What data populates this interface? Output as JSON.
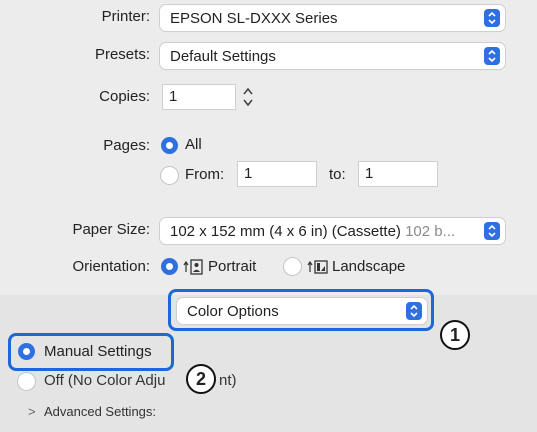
{
  "printer": {
    "label": "Printer:",
    "value": "EPSON SL-DXXX Series"
  },
  "presets": {
    "label": "Presets:",
    "value": "Default Settings"
  },
  "copies": {
    "label": "Copies:",
    "value": "1"
  },
  "pages": {
    "label": "Pages:",
    "all_label": "All",
    "from_label": "From:",
    "from_value": "1",
    "to_label": "to:",
    "to_value": "1"
  },
  "paper_size": {
    "label": "Paper Size:",
    "value": "102 x 152 mm (4 x 6 in) (Cassette)",
    "value_dim": "102 b..."
  },
  "orientation": {
    "label": "Orientation:",
    "portrait_label": "Portrait",
    "landscape_label": "Landscape"
  },
  "color_options": {
    "value": "Color Options"
  },
  "color_mode": {
    "manual_label": "Manual Settings",
    "off_label_left": "Off (No Color Adju",
    "off_label_right": "nt)"
  },
  "advanced": {
    "chevron": ">",
    "label": "Advanced Settings:"
  },
  "callouts": {
    "one": "1",
    "two": "2"
  },
  "colors": {
    "accent": "#2f6fe0",
    "highlight": "#1d67d6"
  }
}
